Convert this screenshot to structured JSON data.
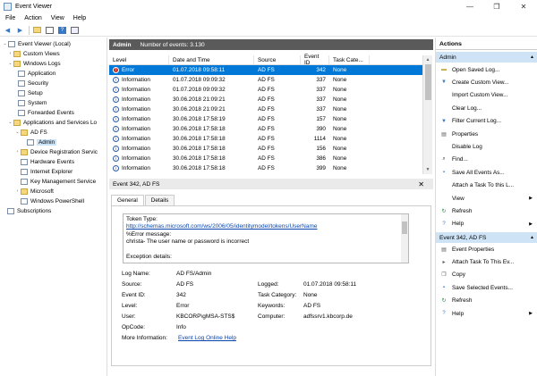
{
  "window": {
    "title": "Event Viewer",
    "minimize": "—",
    "maximize": "❐",
    "close": "✕"
  },
  "menu": [
    "File",
    "Action",
    "View",
    "Help"
  ],
  "tree": {
    "root": "Event Viewer (Local)",
    "custom_views": "Custom Views",
    "windows_logs": "Windows Logs",
    "application": "Application",
    "security": "Security",
    "setup": "Setup",
    "system": "System",
    "forwarded": "Forwarded Events",
    "apps_services": "Applications and Services Lo",
    "adfs": "AD FS",
    "admin": "Admin",
    "device_reg": "Device Registration Servic",
    "hardware": "Hardware Events",
    "ie": "Internet Explorer",
    "kms": "Key Management Service",
    "microsoft": "Microsoft",
    "powershell": "Windows PowerShell",
    "subscriptions": "Subscriptions"
  },
  "middle": {
    "log_name": "Admin",
    "count_label": "Number of events: 3.130",
    "columns": {
      "level": "Level",
      "date": "Date and Time",
      "source": "Source",
      "event_id": "Event ID",
      "task": "Task Cate..."
    },
    "rows": [
      {
        "level": "Error",
        "date": "01.07.2018 09:58:11",
        "source": "AD FS",
        "id": "342",
        "task": "None"
      },
      {
        "level": "Information",
        "date": "01.07.2018 09:09:32",
        "source": "AD FS",
        "id": "337",
        "task": "None"
      },
      {
        "level": "Information",
        "date": "01.07.2018 09:09:32",
        "source": "AD FS",
        "id": "337",
        "task": "None"
      },
      {
        "level": "Information",
        "date": "30.06.2018 21:09:21",
        "source": "AD FS",
        "id": "337",
        "task": "None"
      },
      {
        "level": "Information",
        "date": "30.06.2018 21:09:21",
        "source": "AD FS",
        "id": "337",
        "task": "None"
      },
      {
        "level": "Information",
        "date": "30.06.2018 17:58:19",
        "source": "AD FS",
        "id": "157",
        "task": "None"
      },
      {
        "level": "Information",
        "date": "30.06.2018 17:58:18",
        "source": "AD FS",
        "id": "390",
        "task": "None"
      },
      {
        "level": "Information",
        "date": "30.06.2018 17:58:18",
        "source": "AD FS",
        "id": "1114",
        "task": "None"
      },
      {
        "level": "Information",
        "date": "30.06.2018 17:58:18",
        "source": "AD FS",
        "id": "156",
        "task": "None"
      },
      {
        "level": "Information",
        "date": "30.06.2018 17:58:18",
        "source": "AD FS",
        "id": "386",
        "task": "None"
      },
      {
        "level": "Information",
        "date": "30.06.2018 17:58:18",
        "source": "AD FS",
        "id": "399",
        "task": "None"
      }
    ]
  },
  "detail": {
    "title": "Event 342, AD FS",
    "tab_general": "General",
    "tab_details": "Details",
    "msg_line1": "Token Type:",
    "msg_link": "http://schemas.microsoft.com/ws/2006/05/identitymodel/tokens/UserName",
    "msg_line3": "%Error message:",
    "msg_line4": "christa- The user name or password is incorrect",
    "msg_line5": "",
    "msg_line6": "Exception details:",
    "log_name_label": "Log Name:",
    "log_name": "AD FS/Admin",
    "source_label": "Source:",
    "source": "AD FS",
    "logged_label": "Logged:",
    "logged": "01.07.2018 09:58:11",
    "event_id_label": "Event ID:",
    "event_id": "342",
    "task_label": "Task Category:",
    "task": "None",
    "level_label": "Level:",
    "level": "Error",
    "keywords_label": "Keywords:",
    "keywords": "AD FS",
    "user_label": "User:",
    "user": "KBCORP\\gMSA-STS$",
    "computer_label": "Computer:",
    "computer": "adfssrv1.kbcorp.de",
    "opcode_label": "OpCode:",
    "opcode": "Info",
    "more_label": "More Information:",
    "more_link": "Event Log Online Help"
  },
  "actions": {
    "title": "Actions",
    "section1": "Admin",
    "items1": [
      {
        "label": "Open Saved Log...",
        "icon": "folder-icon"
      },
      {
        "label": "Create Custom View...",
        "icon": "filter-icon"
      },
      {
        "label": "Import Custom View...",
        "icon": ""
      },
      {
        "label": "Clear Log...",
        "icon": ""
      },
      {
        "label": "Filter Current Log...",
        "icon": "filter-icon"
      },
      {
        "label": "Properties",
        "icon": "properties-icon"
      },
      {
        "label": "Disable Log",
        "icon": ""
      },
      {
        "label": "Find...",
        "icon": "find-icon"
      },
      {
        "label": "Save All Events As...",
        "icon": "save-icon"
      },
      {
        "label": "Attach a Task To this L...",
        "icon": ""
      },
      {
        "label": "View",
        "icon": ""
      },
      {
        "label": "Refresh",
        "icon": "refresh-icon"
      },
      {
        "label": "Help",
        "icon": "help-icon"
      }
    ],
    "section2": "Event 342, AD FS",
    "items2": [
      {
        "label": "Event Properties",
        "icon": "properties-icon"
      },
      {
        "label": "Attach Task To This Ev...",
        "icon": "task-icon"
      },
      {
        "label": "Copy",
        "icon": "copy-icon"
      },
      {
        "label": "Save Selected Events...",
        "icon": "save-icon"
      },
      {
        "label": "Refresh",
        "icon": "refresh-icon"
      },
      {
        "label": "Help",
        "icon": "help-icon"
      }
    ]
  }
}
